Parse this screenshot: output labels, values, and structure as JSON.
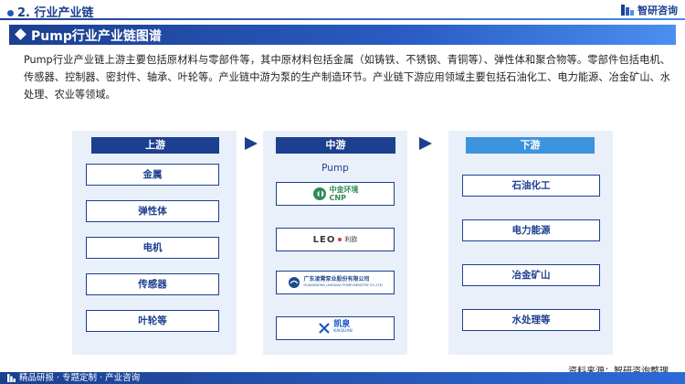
{
  "header": {
    "section_title": "2. 行业产业链",
    "brand_name": "智研咨询",
    "brand_icon": "zhiyan-logo-icon"
  },
  "banner": {
    "title": "Pump行业产业链图谱"
  },
  "intro": {
    "paragraph": "Pump行业产业链上游主要包括原材料与零部件等，其中原材料包括金属（如铸铁、不锈钢、青铜等）、弹性体和聚合物等。零部件包括电机、传感器、控制器、密封件、轴承、叶轮等。产业链中游为泵的生产制造环节。产业链下游应用领域主要包括石油化工、电力能源、冶金矿山、水处理、农业等领域。"
  },
  "chain": {
    "upstream": {
      "label": "上游",
      "items": [
        "金属",
        "弹性体",
        "电机",
        "传感器",
        "叶轮等"
      ]
    },
    "midstream": {
      "label": "中游",
      "product": "Pump",
      "companies": [
        {
          "logo_text": "中金环境",
          "logo_sub": "CNP",
          "icon": "cnp-logo-icon",
          "color": "#2e8b57"
        },
        {
          "logo_text": "LEO",
          "logo_sub": "利欧",
          "icon": "leo-logo-icon",
          "color": "#3a3a3a"
        },
        {
          "logo_text": "广东凌霄泵业股份有限公司",
          "logo_sub": "GUANGDONG LINGXIAO PUMP INDUSTRY CO.,LTD",
          "icon": "lingxiao-logo-icon",
          "color": "#1d4a8a"
        },
        {
          "logo_text": "凯泉",
          "logo_sub": "KAIQUAN",
          "icon": "kaiquan-logo-icon",
          "color": "#1c57c4"
        }
      ]
    },
    "downstream": {
      "label": "下游",
      "items": [
        "石油化工",
        "电力能源",
        "冶金矿山",
        "水处理等"
      ]
    }
  },
  "footer": {
    "tagline": "精品研报 · 专题定制 · 产业咨询",
    "source": "资料来源：智研咨询整理"
  },
  "colors": {
    "primary": "#1c3f8f",
    "accent": "#3d93dc",
    "panel_bg": "#e9f0fa"
  }
}
